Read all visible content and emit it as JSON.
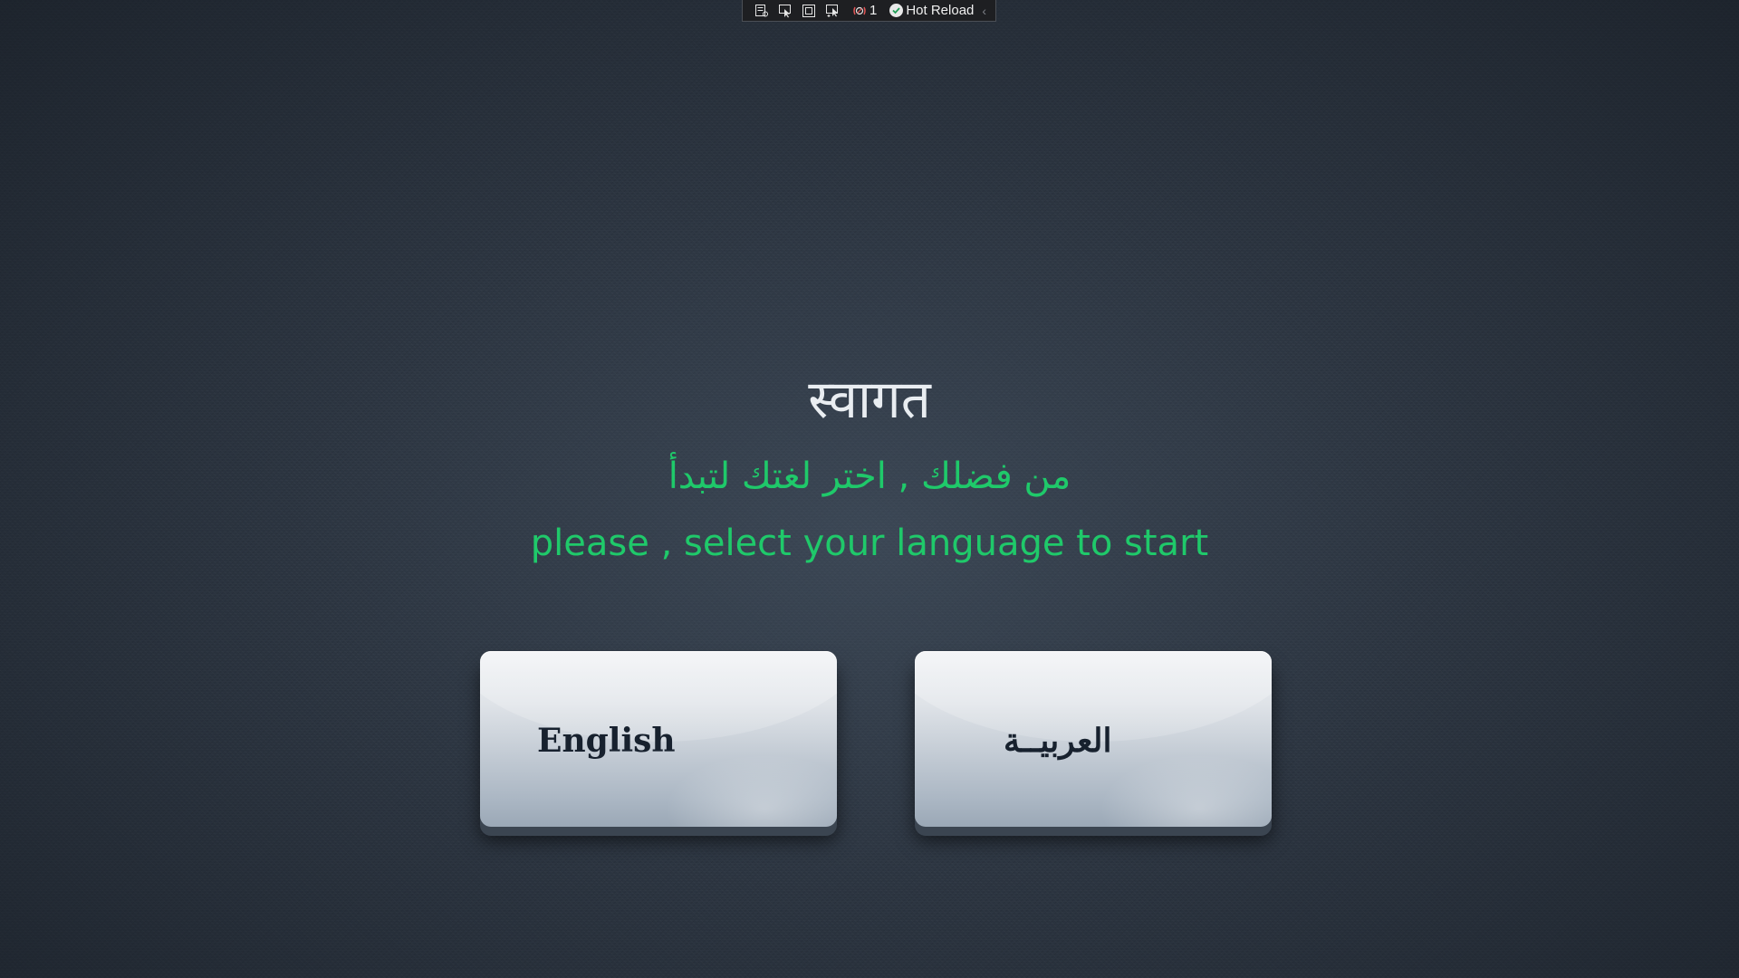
{
  "toolbar": {
    "icons": [
      "live-visual-tree-icon",
      "select-element-icon",
      "display-layout-adorners-icon",
      "track-focus-icon",
      "binding-failures-icon"
    ],
    "binding_failures_count": "1",
    "hot_reload_label": "Hot Reload",
    "collapse_glyph": "‹"
  },
  "welcome": {
    "title": "स्वागत",
    "subtitle_arabic": "من فضلك , اختر لغتك لتبدأ",
    "subtitle_english": "please , select your language to start"
  },
  "languages": {
    "english_label": "English",
    "arabic_label": "العربيــة"
  },
  "colors": {
    "accent_green": "#1fc96a",
    "title_white": "#e9edf1",
    "background": "#2c3541",
    "button_text": "#17212e"
  }
}
